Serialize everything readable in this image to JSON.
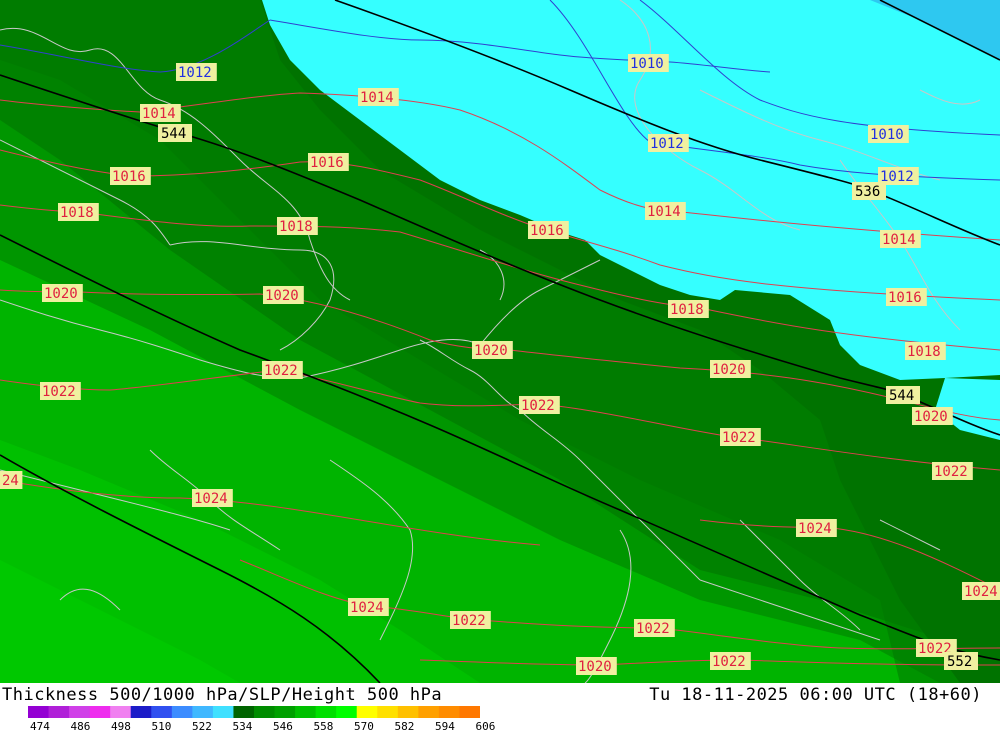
{
  "title": "Thickness 500/1000 hPa/SLP/Height 500 hPa",
  "valid_time": "Tu 18-11-2025 06:00 UTC (18+60)",
  "legend": {
    "ticks": [
      "474",
      "486",
      "498",
      "510",
      "522",
      "534",
      "546",
      "558",
      "570",
      "582",
      "594",
      "606"
    ],
    "colors": [
      "#9400d3",
      "#b020d8",
      "#d040e8",
      "#ee2cee",
      "#f080f0",
      "#1c1cc8",
      "#3050f0",
      "#3c8cff",
      "#40b8ff",
      "#40e0ff",
      "#006400",
      "#008c00",
      "#00a000",
      "#00c000",
      "#00e000",
      "#00ff00",
      "#ffff00",
      "#ffe000",
      "#ffc000",
      "#ffa000",
      "#ff8c00",
      "#ff7800"
    ]
  },
  "pressure_labels": [
    {
      "text": "1012",
      "color": "#2030e0"
    },
    {
      "text": "1014",
      "color": "#e02040"
    },
    {
      "text": "1014",
      "color": "#e02040"
    },
    {
      "text": "1010",
      "color": "#2030e0"
    },
    {
      "text": "1012",
      "color": "#2030e0"
    },
    {
      "text": "1010",
      "color": "#2030e0"
    },
    {
      "text": "1012",
      "color": "#2030e0"
    },
    {
      "text": "1016",
      "color": "#e02040"
    },
    {
      "text": "1016",
      "color": "#e02040"
    },
    {
      "text": "1018",
      "color": "#e02040"
    },
    {
      "text": "1018",
      "color": "#e02040"
    },
    {
      "text": "1016",
      "color": "#e02040"
    },
    {
      "text": "1014",
      "color": "#e02040"
    },
    {
      "text": "1014",
      "color": "#e02040"
    },
    {
      "text": "1016",
      "color": "#e02040"
    },
    {
      "text": "1020",
      "color": "#e02040"
    },
    {
      "text": "1020",
      "color": "#e02040"
    },
    {
      "text": "1018",
      "color": "#e02040"
    },
    {
      "text": "1020",
      "color": "#e02040"
    },
    {
      "text": "1018",
      "color": "#e02040"
    },
    {
      "text": "1022",
      "color": "#e02040"
    },
    {
      "text": "1022",
      "color": "#e02040"
    },
    {
      "text": "1020",
      "color": "#e02040"
    },
    {
      "text": "1022",
      "color": "#e02040"
    },
    {
      "text": "1020",
      "color": "#e02040"
    },
    {
      "text": "1022",
      "color": "#e02040"
    },
    {
      "text": "1022",
      "color": "#e02040"
    },
    {
      "text": "24",
      "color": "#e02040"
    },
    {
      "text": "1024",
      "color": "#e02040"
    },
    {
      "text": "1024",
      "color": "#e02040"
    },
    {
      "text": "1024",
      "color": "#e02040"
    },
    {
      "text": "1024",
      "color": "#e02040"
    },
    {
      "text": "1022",
      "color": "#e02040"
    },
    {
      "text": "1022",
      "color": "#e02040"
    },
    {
      "text": "1020",
      "color": "#e02040"
    },
    {
      "text": "1022",
      "color": "#e02040"
    },
    {
      "text": "1022",
      "color": "#e02040"
    }
  ],
  "height_labels": [
    "544",
    "536",
    "544",
    "552"
  ]
}
